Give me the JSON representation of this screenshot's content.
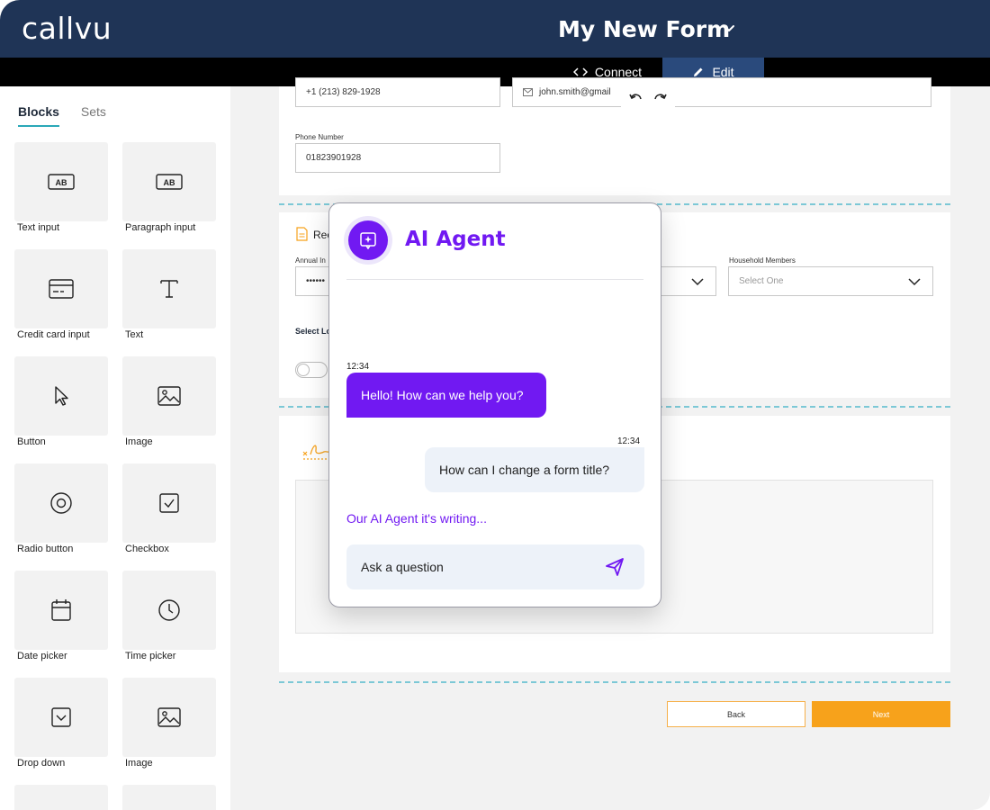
{
  "header": {
    "logo": "callvu",
    "form_title": "My New Form"
  },
  "modes": {
    "connect": "Connect",
    "edit": "Edit"
  },
  "sidebar": {
    "tabs": [
      "Blocks",
      "Sets"
    ],
    "blocks": [
      {
        "label": "Text input",
        "icon": "text-input-icon"
      },
      {
        "label": "Paragraph input",
        "icon": "paragraph-input-icon"
      },
      {
        "label": "Credit card input",
        "icon": "credit-card-icon"
      },
      {
        "label": "Text",
        "icon": "text-icon"
      },
      {
        "label": "Button",
        "icon": "cursor-icon"
      },
      {
        "label": "Image",
        "icon": "image-icon"
      },
      {
        "label": "Radio button",
        "icon": "radio-icon"
      },
      {
        "label": "Checkbox",
        "icon": "checkbox-icon"
      },
      {
        "label": "Date picker",
        "icon": "calendar-icon"
      },
      {
        "label": "Time picker",
        "icon": "clock-icon"
      },
      {
        "label": "Drop down",
        "icon": "dropdown-icon"
      },
      {
        "label": "Image",
        "icon": "image-icon"
      }
    ]
  },
  "form": {
    "phone_value_top": "+1 (213) 829-1928",
    "email_value": "john.smith@gmail",
    "phone_label": "Phone Number",
    "phone_value": "01823901928",
    "section2_title_fragment": "Rec",
    "annual_label_fragment": "Annual In",
    "annual_value": "••••••",
    "household_label": "Household Members",
    "household_placeholder": "Select One",
    "select_label_fragment": "Select Lo",
    "back_label": "Back",
    "next_label": "Next"
  },
  "chat": {
    "title": "AI Agent",
    "agent_time": "12:34",
    "agent_message": "Hello! How can we help you?",
    "user_time": "12:34",
    "user_message": "How can I change a form title?",
    "typing_status": "Our AI Agent it's writing...",
    "input_placeholder": "Ask a question"
  },
  "colors": {
    "header_bg": "#1f3456",
    "accent_purple": "#7119f2",
    "next_orange": "#f7a21b",
    "dashed_teal": "#7cc8d6"
  }
}
